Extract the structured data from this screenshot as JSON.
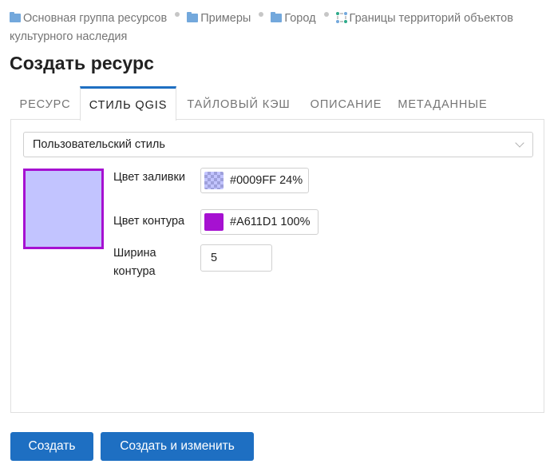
{
  "breadcrumb": {
    "items": [
      {
        "label": "Основная группа ресурсов"
      },
      {
        "label": "Примеры"
      },
      {
        "label": "Город"
      },
      {
        "label": "Границы территорий объектов культурного наследия"
      }
    ]
  },
  "page_title": "Создать ресурс",
  "tabs": [
    {
      "label": "РЕСУРС",
      "active": false
    },
    {
      "label": "СТИЛЬ QGIS",
      "active": true
    },
    {
      "label": "ТАЙЛОВЫЙ КЭШ",
      "active": false
    },
    {
      "label": "ОПИСАНИЕ",
      "active": false
    },
    {
      "label": "МЕТАДАННЫЕ",
      "active": false
    }
  ],
  "style_form": {
    "style_type": {
      "value": "Пользовательский стиль"
    },
    "fill_color": {
      "label": "Цвет заливки",
      "value": "#0009FF 24%",
      "color": "#0009FF",
      "opacity": 0.24
    },
    "stroke_color": {
      "label": "Цвет контура",
      "value": "#A611D1 100%",
      "color": "#A611D1",
      "opacity": 1
    },
    "stroke_width": {
      "label": "Ширина контура",
      "value": "5"
    }
  },
  "buttons": {
    "create": "Создать",
    "create_and_edit": "Создать и изменить"
  },
  "colors": {
    "accent": "#1E6FC2",
    "folder_icon": "#73A8DC"
  }
}
